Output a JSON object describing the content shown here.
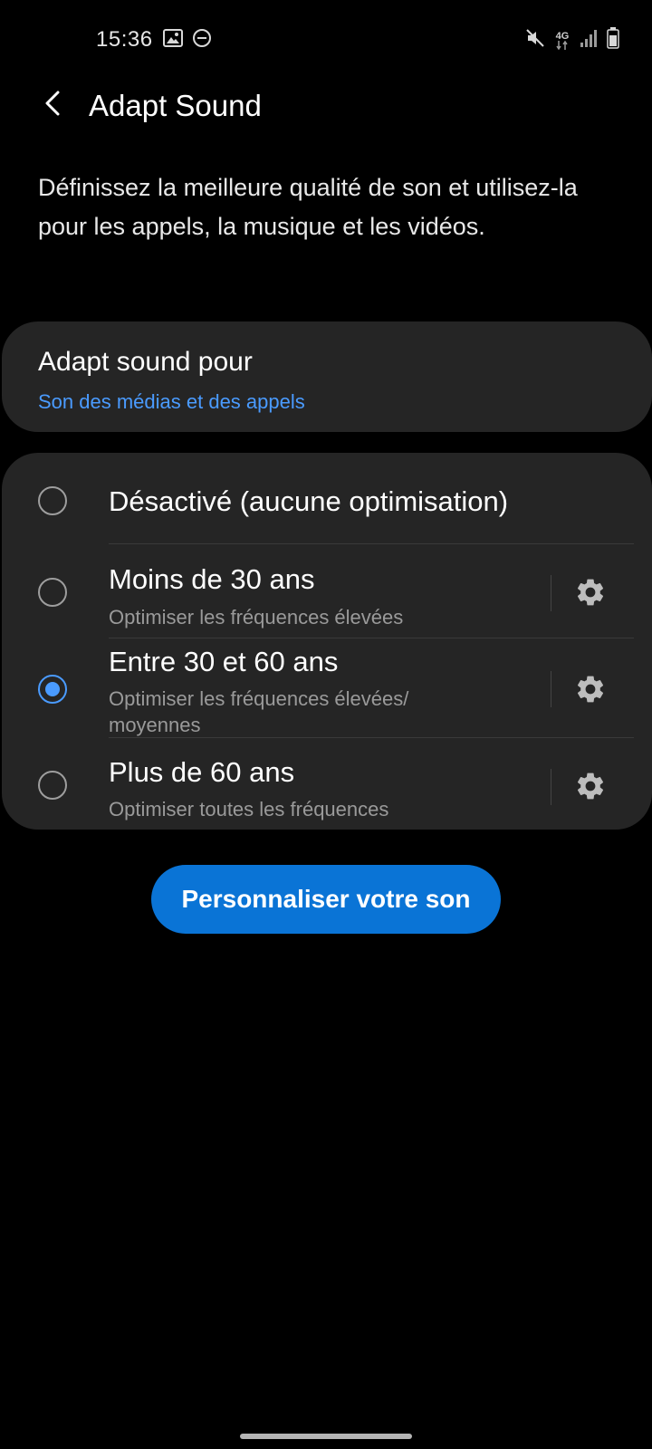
{
  "status_bar": {
    "time": "15:36",
    "network": "4G",
    "icons": [
      "image-icon",
      "dnd-icon",
      "mute-icon",
      "network-4g-icon",
      "signal-icon",
      "battery-icon"
    ]
  },
  "header": {
    "title": "Adapt Sound",
    "back_icon": "chevron-left-icon"
  },
  "description": "Définissez la meilleure qualité de son et utilisez-la pour les appels, la musique et les vidéos.",
  "target_card": {
    "label": "Adapt sound pour",
    "value": "Son des médias et des appels"
  },
  "options": [
    {
      "title": "Désactivé (aucune optimisation)",
      "subtitle": "",
      "selected": false,
      "has_settings": false
    },
    {
      "title": "Moins de 30 ans",
      "subtitle": "Optimiser les fréquences élevées",
      "selected": false,
      "has_settings": true
    },
    {
      "title": "Entre 30 et 60 ans",
      "subtitle": "Optimiser les fréquences élevées/ moyennes",
      "selected": true,
      "has_settings": true
    },
    {
      "title": "Plus de 60 ans",
      "subtitle": "Optimiser toutes les fréquences",
      "selected": false,
      "has_settings": true
    }
  ],
  "customize_button": {
    "label": "Personnaliser votre son"
  },
  "colors": {
    "background": "#000000",
    "card": "#252525",
    "accent": "#4a9bff",
    "button": "#0a74d6",
    "secondary_text": "#9a9a9a"
  }
}
